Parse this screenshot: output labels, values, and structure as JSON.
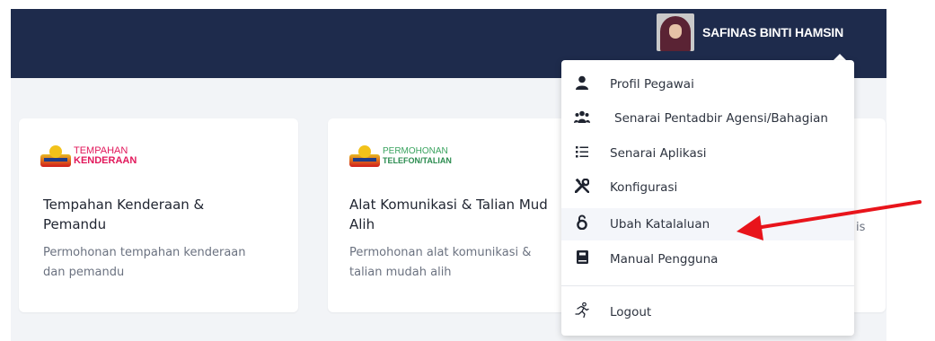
{
  "header": {
    "user_name": "SAFINAS BINTI HAMSIN"
  },
  "cards": [
    {
      "logo_line1": "TEMPAHAN",
      "logo_line2": "KENDERAAN",
      "title_line1": "Tempahan Kenderaan &",
      "title_line2": "Pemandu",
      "desc_line1": "Permohonan tempahan kenderaan",
      "desc_line2": "dan pemandu"
    },
    {
      "logo_line1": "PERMOHONAN",
      "logo_line2": "TELEFON/TALIAN",
      "title_line1": "Alat Komunikasi & Talian Mud",
      "title_line2": "Alih",
      "desc_line1": "Permohonan alat komunikasi &",
      "desc_line2": "talian mudah alih"
    }
  ],
  "partial_text": "is",
  "menu": {
    "items": [
      {
        "label": "Profil Pegawai",
        "icon": "user-icon"
      },
      {
        "label": "Senarai Pentadbir Agensi/Bahagian",
        "icon": "users-icon"
      },
      {
        "label": "Senarai Aplikasi",
        "icon": "list-icon"
      },
      {
        "label": "Konfigurasi",
        "icon": "tools-icon"
      },
      {
        "label": "Ubah Katalaluan",
        "icon": "password-icon"
      },
      {
        "label": "Manual Pengguna",
        "icon": "book-icon"
      },
      {
        "label": "Logout",
        "icon": "running-icon"
      }
    ]
  },
  "colors": {
    "header_bg": "#1e2b4c",
    "arrow": "#e8141b",
    "logo_pink": "#e2185b",
    "logo_green": "#3aa35f"
  }
}
